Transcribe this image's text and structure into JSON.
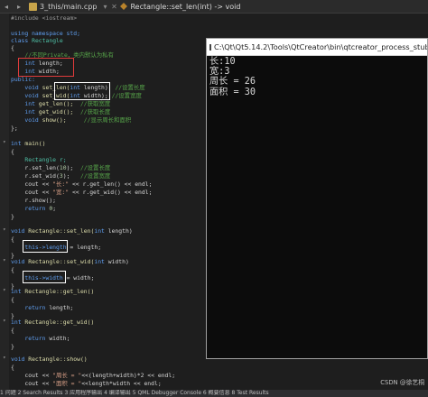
{
  "tab": {
    "file_name": "3_this/main.cpp",
    "function_name": "Rectangle::set_len(int) -> void"
  },
  "code": {
    "l1": "#include <iostream>",
    "l2": "using namespace std;",
    "l3a": "class",
    "l3b": "Rectangle",
    "l4": "{",
    "l5": "    //不同Private，类内默认为私有",
    "l6a": "    int",
    "l6b": " length;",
    "l7a": "    int",
    "l7b": " width;",
    "l8": "public:",
    "l9a": "    void",
    "l9b": " set_len(",
    "l9c": "int",
    "l9d": " length)",
    "l9e": "  //设置长度",
    "l10a": "    void",
    "l10b": " set_wid(",
    "l10c": "int",
    "l10d": " width);",
    "l10e": " //设置宽度",
    "l11a": "    int",
    "l11b": " get_len();",
    "l11c": "  //获取宽度",
    "l12a": "    int",
    "l12b": " get_wid();",
    "l12c": "  //获取长度",
    "l13a": "    void",
    "l13b": " show();",
    "l13c": "     //显示周长和面积",
    "l14": "};",
    "l15a": "int",
    "l15b": " main()",
    "l16": "{",
    "l17": "    Rectangle r;",
    "l18a": "    r.set_len(",
    "l18b": "10",
    "l18c": ");",
    "l18d": "  //设置长度",
    "l19a": "    r.set_wid(",
    "l19b": "3",
    "l19c": ");",
    "l19d": "   //设置宽度",
    "l20a": "    cout << ",
    "l20b": "\"长:\"",
    "l20c": " << r.get_len() << endl;",
    "l21a": "    cout << ",
    "l21b": "\"宽:\"",
    "l21c": " << r.get_wid() << endl;",
    "l22": "    r.show();",
    "l23a": "    return",
    "l23b": " 0",
    "l23c": ";",
    "l24": "}",
    "l25a": "void",
    "l25b": " Rectangle::set_len(",
    "l25c": "int",
    "l25d": " length)",
    "l26": "{",
    "l27a": "    this->length",
    "l27b": " = length;",
    "l28": "}",
    "l29a": "void",
    "l29b": " Rectangle::set_wid(",
    "l29c": "int",
    "l29d": " width)",
    "l30": "{",
    "l31a": "    this->width",
    "l31b": " = width;",
    "l32": "}",
    "l33a": "int",
    "l33b": " Rectangle::get_len()",
    "l34": "{",
    "l35a": "    return",
    "l35b": " length;",
    "l36": "}",
    "l37a": "int",
    "l37b": " Rectangle::get_wid()",
    "l38": "{",
    "l39a": "    return",
    "l39b": " width;",
    "l40": "}",
    "l41a": "void",
    "l41b": " Rectangle::show()",
    "l42": "{",
    "l43a": "    cout << ",
    "l43b": "\"周长 = \"",
    "l43c": "<<(length+width)*2 << endl;",
    "l44a": "    cout << ",
    "l44b": "\"面积 = \"",
    "l44c": "<<length*width << endl;"
  },
  "console": {
    "title": "C:\\Qt\\Qt5.14.2\\Tools\\QtCreator\\bin\\qtcreator_process_stub.exe",
    "lines": [
      "长:10",
      "宽:3",
      "周长 = 26",
      "面积 = 30"
    ]
  },
  "watermark": "CSDN @徐艺桐",
  "statusbar": "  1 问题  2 Search Results  3 应用程序输出  4 编译输出  5 QML Debugger Console  6 概要信息  8 Test Results"
}
